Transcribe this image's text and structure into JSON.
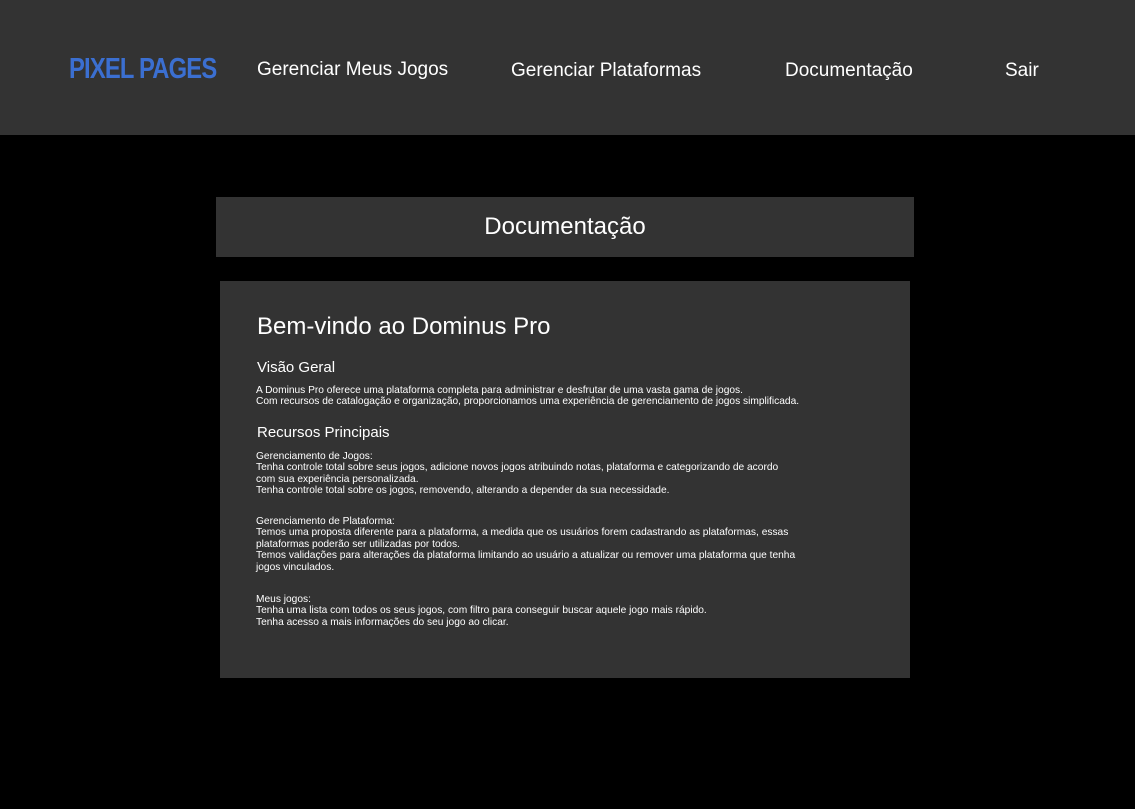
{
  "app": {
    "logo": "PIXEL PAGES",
    "brand_color": "#3b6fd1"
  },
  "nav": {
    "items": [
      {
        "label": "Gerenciar Meus Jogos"
      },
      {
        "label": "Gerenciar Plataformas"
      },
      {
        "label": "Documentação"
      },
      {
        "label": "Sair"
      }
    ]
  },
  "page": {
    "title": "Documentação"
  },
  "doc": {
    "heading": "Bem-vindo ao Dominus Pro",
    "overview": {
      "title": "Visão Geral",
      "lines": [
        "A Dominus Pro oferece uma plataforma completa para administrar e desfrutar de uma vasta gama de jogos.",
        "Com recursos de catalogação e organização, proporcionamos uma experiência de gerenciamento de jogos simplificada."
      ]
    },
    "features": {
      "title": "Recursos Principais",
      "blocks": [
        {
          "lines": [
            "Gerenciamento de Jogos:",
            "Tenha controle total sobre seus jogos, adicione novos jogos atribuindo notas, plataforma e categorizando de acordo",
            "com sua experiência personalizada.",
            "Tenha controle total sobre os jogos, removendo, alterando a depender da sua necessidade."
          ]
        },
        {
          "lines": [
            "Gerenciamento de Plataforma:",
            "Temos uma proposta diferente para a plataforma, a medida que os usuários forem cadastrando as plataformas, essas",
            "plataformas poderão ser utilizadas por todos.",
            "Temos validações para alterações da plataforma limitando ao usuário a atualizar ou remover uma plataforma que tenha",
            "jogos vinculados."
          ]
        },
        {
          "lines": [
            "Meus jogos:",
            "Tenha uma lista com todos os seus jogos, com filtro para conseguir buscar aquele jogo mais rápido.",
            "Tenha acesso a mais informações do seu jogo ao clicar."
          ]
        }
      ]
    }
  }
}
